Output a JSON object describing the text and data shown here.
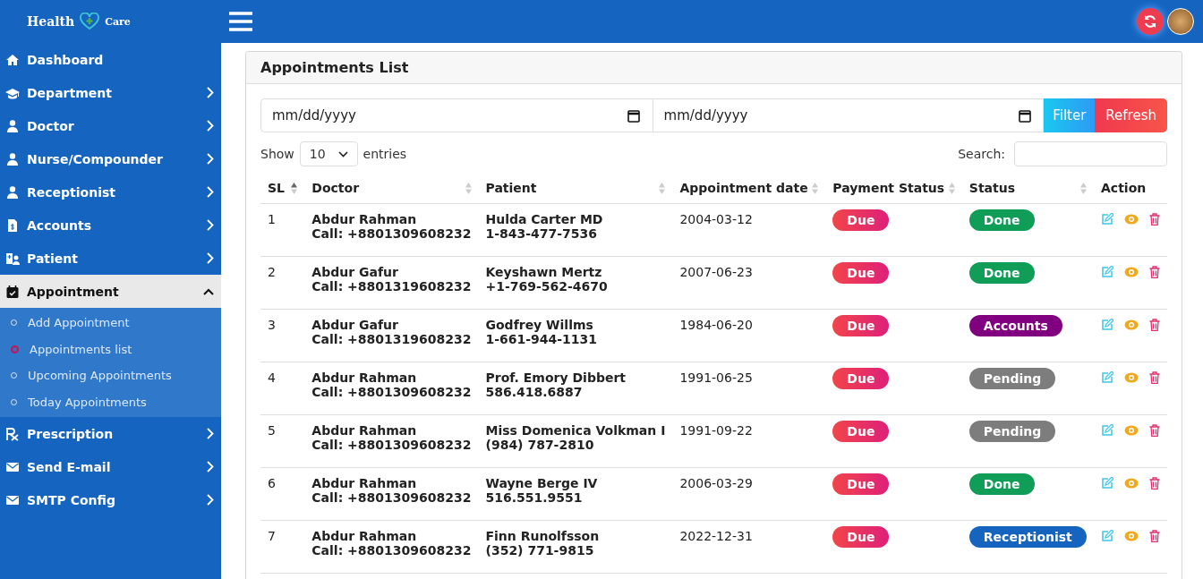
{
  "brand": {
    "word_1": "Health",
    "word_2": "Care"
  },
  "sidebar": {
    "items": [
      {
        "label": "Dashboard",
        "has_submenu": false,
        "expanded": false,
        "selected": false
      },
      {
        "label": "Department",
        "has_submenu": true,
        "expanded": false,
        "selected": false
      },
      {
        "label": "Doctor",
        "has_submenu": true,
        "expanded": false,
        "selected": false
      },
      {
        "label": "Nurse/Compounder",
        "has_submenu": true,
        "expanded": false,
        "selected": false
      },
      {
        "label": "Receptionist",
        "has_submenu": true,
        "expanded": false,
        "selected": false
      },
      {
        "label": "Accounts",
        "has_submenu": true,
        "expanded": false,
        "selected": false
      },
      {
        "label": "Patient",
        "has_submenu": true,
        "expanded": false,
        "selected": false
      },
      {
        "label": "Appointment",
        "has_submenu": true,
        "expanded": true,
        "selected": true,
        "children": [
          {
            "label": "Add Appointment",
            "selected": false
          },
          {
            "label": "Appointments list",
            "selected": true
          },
          {
            "label": "Upcoming Appointments",
            "selected": false
          },
          {
            "label": "Today Appointments",
            "selected": false
          }
        ]
      },
      {
        "label": "Prescription",
        "has_submenu": true,
        "expanded": false,
        "selected": false
      },
      {
        "label": "Send E-mail",
        "has_submenu": true,
        "expanded": false,
        "selected": false
      },
      {
        "label": "SMTP Config",
        "has_submenu": true,
        "expanded": false,
        "selected": false
      }
    ]
  },
  "card": {
    "title": "Appointments List",
    "date_from": {
      "placeholder": "mm/dd/yyyy"
    },
    "date_to": {
      "placeholder": "mm/dd/yyyy"
    },
    "filter_button": "Filter",
    "refresh_button": "Refresh",
    "show_label": "Show",
    "entries_value": "10",
    "entries_label": "entries",
    "search_label": "Search:",
    "table": {
      "columns": [
        "SL",
        "Doctor",
        "Patient",
        "Appointment date",
        "Payment Status",
        "Status",
        "Action"
      ],
      "rows": [
        {
          "sl": "1",
          "doctor": "Abdur Rahman",
          "doctor_phone": "Call: +8801309608232",
          "patient": "Hulda Carter MD",
          "patient_phone": "1-843-477-7536",
          "date": "2004-03-12",
          "payment": "Due",
          "status": {
            "label": "Done",
            "color": "#0f9d58"
          }
        },
        {
          "sl": "2",
          "doctor": "Abdur Gafur",
          "doctor_phone": "Call: +8801319608232",
          "patient": "Keyshawn Mertz",
          "patient_phone": "+1-769-562-4670",
          "date": "2007-06-23",
          "payment": "Due",
          "status": {
            "label": "Done",
            "color": "#0f9d58"
          }
        },
        {
          "sl": "3",
          "doctor": "Abdur Gafur",
          "doctor_phone": "Call: +8801319608232",
          "patient": "Godfrey Willms",
          "patient_phone": "1-661-944-1131",
          "date": "1984-06-20",
          "payment": "Due",
          "status": {
            "label": "Accounts",
            "color": "#800080"
          }
        },
        {
          "sl": "4",
          "doctor": "Abdur Rahman",
          "doctor_phone": "Call: +8801309608232",
          "patient": "Prof. Emory Dibbert",
          "patient_phone": "586.418.6887",
          "date": "1991-06-25",
          "payment": "Due",
          "status": {
            "label": "Pending",
            "color": "#7d7d7d"
          }
        },
        {
          "sl": "5",
          "doctor": "Abdur Rahman",
          "doctor_phone": "Call: +8801309608232",
          "patient": "Miss Domenica Volkman I",
          "patient_phone": "(984) 787-2810",
          "date": "1991-09-22",
          "payment": "Due",
          "status": {
            "label": "Pending",
            "color": "#7d7d7d"
          }
        },
        {
          "sl": "6",
          "doctor": "Abdur Rahman",
          "doctor_phone": "Call: +8801309608232",
          "patient": "Wayne Berge IV",
          "patient_phone": "516.551.9551",
          "date": "2006-03-29",
          "payment": "Due",
          "status": {
            "label": "Done",
            "color": "#0f9d58"
          }
        },
        {
          "sl": "7",
          "doctor": "Abdur Rahman",
          "doctor_phone": "Call: +8801309608232",
          "patient": "Finn Runolfsson",
          "patient_phone": "(352) 771-9815",
          "date": "2022-12-31",
          "payment": "Due",
          "status": {
            "label": "Receptionist",
            "color": "#1565c0"
          }
        }
      ]
    }
  }
}
